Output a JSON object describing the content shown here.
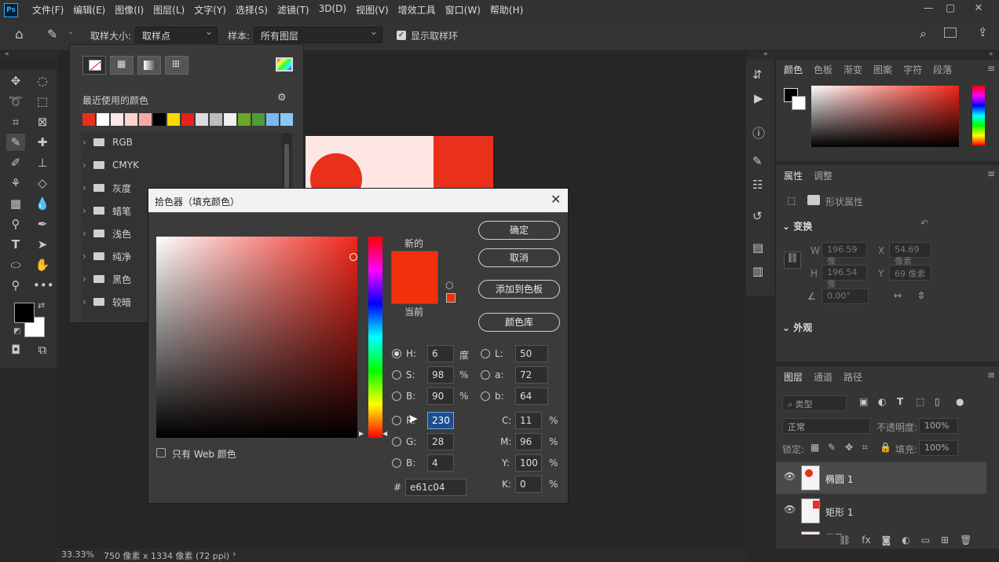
{
  "app": {
    "logo": "Ps"
  },
  "menu": [
    "文件(F)",
    "编辑(E)",
    "图像(I)",
    "图层(L)",
    "文字(Y)",
    "选择(S)",
    "滤镜(T)",
    "3D(D)",
    "视图(V)",
    "增效工具",
    "窗口(W)",
    "帮助(H)"
  ],
  "options": {
    "sample_size_label": "取样大小:",
    "sample_size_value": "取样点",
    "sample_label": "样本:",
    "sample_value": "所有图层",
    "show_ring_label": "显示取样环"
  },
  "swatches_panel": {
    "recent_label": "最近使用的颜色",
    "recent_colors": [
      "#e8301a",
      "#ffffff",
      "#fde6e4",
      "#fdd2cf",
      "#f5aaa5",
      "#000000",
      "#ffd800",
      "#e62020",
      "#dddddd",
      "#bcbcbc",
      "#f0f0f0",
      "#6aa628",
      "#4f9a3a",
      "#7ab8ee",
      "#88c8f5"
    ],
    "groups": [
      "RGB",
      "CMYK",
      "灰度",
      "蜡笔",
      "浅色",
      "纯净",
      "黑色",
      "较暗"
    ]
  },
  "canvas": {
    "shape_color": "#e61c04",
    "bg_pink": "#fde6e4"
  },
  "color_picker": {
    "title": "拾色器（填充颜色）",
    "new_label": "新的",
    "current_label": "当前",
    "new_color": "#e61c04",
    "current_color": "#e61c04",
    "buttons": {
      "ok": "确定",
      "cancel": "取消",
      "add_to_swatches": "添加到色板",
      "color_libraries": "颜色库"
    },
    "web_only_label": "只有 Web 颜色",
    "hsb": {
      "h_label": "H:",
      "h": "6",
      "h_unit": "度",
      "s_label": "S:",
      "s": "98",
      "s_unit": "%",
      "b_label": "B:",
      "b": "90",
      "b_unit": "%"
    },
    "rgb": {
      "r_label": "R:",
      "r": "230",
      "g_label": "G:",
      "g": "28",
      "b_label": "B:",
      "b": "4"
    },
    "lab": {
      "l_label": "L:",
      "l": "50",
      "a_label": "a:",
      "a": "72",
      "b_label": "b:",
      "b": "64"
    },
    "cmyk": {
      "c_label": "C:",
      "c": "11",
      "m_label": "M:",
      "m": "96",
      "y_label": "Y:",
      "y": "100",
      "k_label": "K:",
      "k": "0",
      "unit": "%"
    },
    "hex_label": "#",
    "hex": "e61c04"
  },
  "color_panel": {
    "tabs": [
      "颜色",
      "色板",
      "渐变",
      "图案",
      "字符",
      "段落"
    ]
  },
  "properties_panel": {
    "tabs": [
      "属性",
      "调整"
    ],
    "shape_props_label": "形状属性",
    "transform_label": "变换",
    "w_label": "W",
    "w_value": "196.59 像",
    "x_label": "X",
    "x_value": "54.69 像素",
    "h_label": "H",
    "h_value": "196.54 像",
    "y_label": "Y",
    "y_value": "69 像素",
    "angle_value": "0.00°",
    "appearance_label": "外观"
  },
  "layers_panel": {
    "tabs": [
      "图层",
      "通道",
      "路径"
    ],
    "filter_placeholder": "类型",
    "blend_mode": "正常",
    "opacity_label": "不透明度:",
    "opacity_value": "100%",
    "lock_label": "锁定:",
    "fill_label": "填充:",
    "fill_value": "100%",
    "layers": [
      {
        "name": "椭圆 1"
      },
      {
        "name": "矩形 1"
      },
      {
        "name": "背景"
      }
    ]
  },
  "status": {
    "zoom": "33.33%",
    "doc_info": "750 像素 x 1334 像素 (72 ppi)"
  }
}
